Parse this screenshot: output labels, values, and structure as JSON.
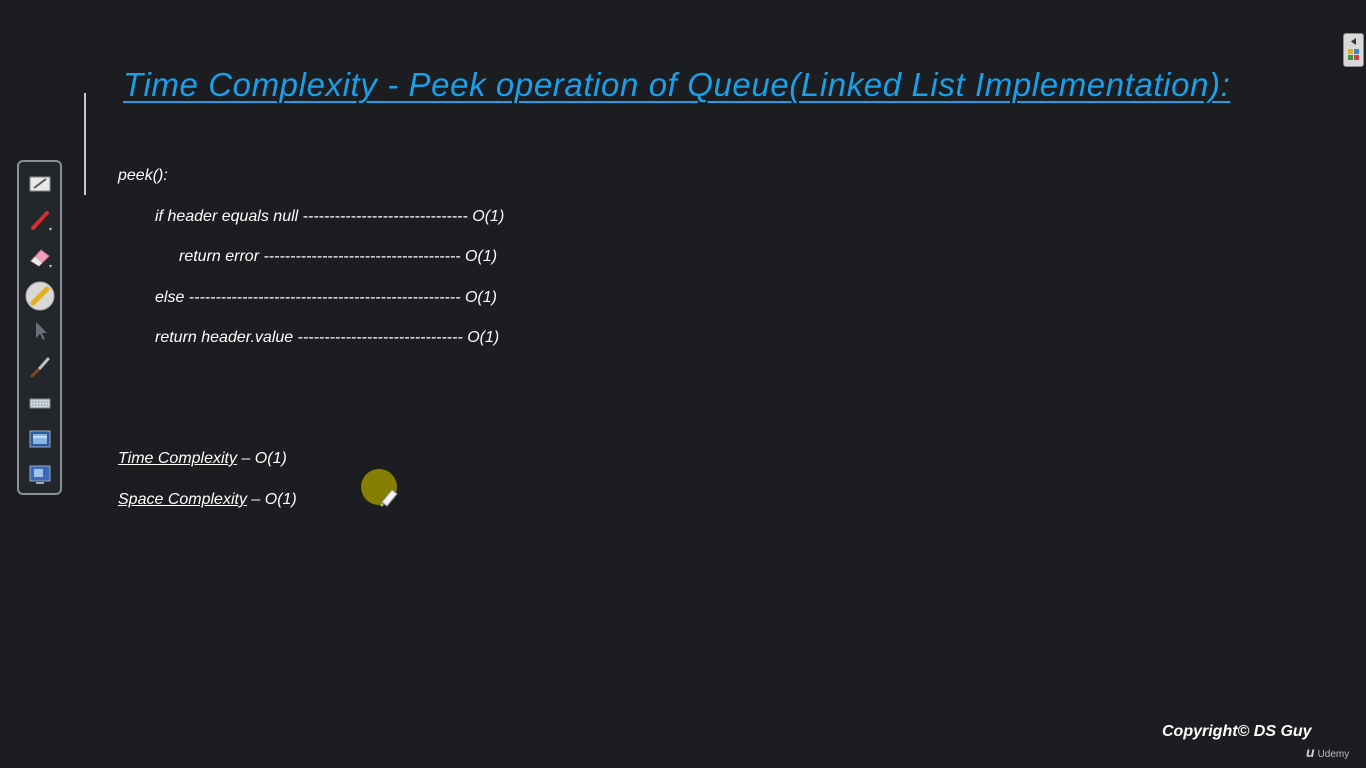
{
  "title": "Time Complexity - Peek operation of Queue(Linked List Implementation):",
  "code": {
    "fn": "peek():",
    "lines": [
      "if header equals null ------------------------------- O(1)",
      "return error ------------------------------------- O(1)",
      "else --------------------------------------------------- O(1)",
      "return header.value ------------------------------- O(1)"
    ]
  },
  "summary": {
    "time_label": "Time Complexity",
    "time_value": " – O(1)",
    "space_label": "Space Complexity",
    "space_value": " – O(1)"
  },
  "toolbar": {
    "tools": [
      "whiteboard-icon",
      "pen-icon",
      "eraser-icon",
      "highlighter-icon",
      "pointer-icon",
      "brush-icon",
      "keyboard-icon",
      "screen-capture-icon",
      "display-icon"
    ]
  },
  "footer": {
    "copyright": "Copyright© DS Guy",
    "brand_mark": "u",
    "brand_name": "Udemy"
  },
  "colors": {
    "background": "#1b1d20",
    "title": "#1a9fe8",
    "cursor": "#8c8400"
  }
}
